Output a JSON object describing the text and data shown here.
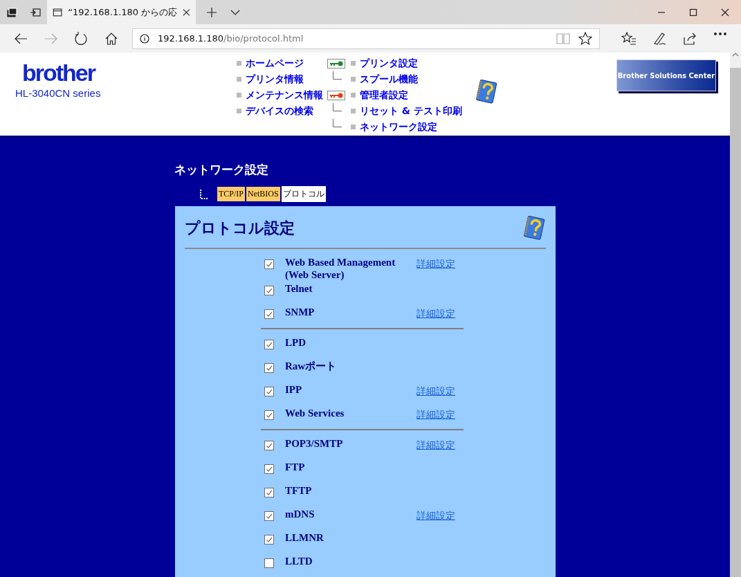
{
  "browser": {
    "tab_title": "“192.168.1.180 からの応",
    "url_host": "192.168.1.180",
    "url_path": "/bio/protocol.html"
  },
  "header": {
    "logo": "brother",
    "model": "HL-3040CN series",
    "banner": "Brother Solutions Center",
    "nav_left": [
      "ホームページ",
      "プリンタ情報",
      "メンテナンス情報",
      "デバイスの検索"
    ],
    "nav_right": [
      {
        "color": "#1a8a2a",
        "items": [
          "プリンタ設定",
          "スプール機能"
        ]
      },
      {
        "color": "#e0401a",
        "items": [
          "管理者設定",
          "リセット & テスト印刷",
          "ネットワーク設定"
        ]
      }
    ]
  },
  "section_title": "ネットワーク設定",
  "breadcrumbs": [
    {
      "label": "TCP/IP",
      "selected": false
    },
    {
      "label": "NetBIOS",
      "selected": false
    },
    {
      "label": "プロトコル",
      "selected": true
    }
  ],
  "panel": {
    "title": "プロトコル設定",
    "groups": [
      [
        {
          "label": "Web Based Management (Web Server)",
          "checked": true,
          "link": "詳細設定"
        },
        {
          "label": "Telnet",
          "checked": true
        },
        {
          "label": "SNMP",
          "checked": true,
          "link": "詳細設定"
        }
      ],
      [
        {
          "label": "LPD",
          "checked": true
        },
        {
          "label": "Rawポート",
          "checked": true
        },
        {
          "label": "IPP",
          "checked": true,
          "link": "詳細設定"
        },
        {
          "label": "Web Services",
          "checked": true,
          "link": "詳細設定"
        }
      ],
      [
        {
          "label": "POP3/SMTP",
          "checked": true,
          "link": "詳細設定"
        },
        {
          "label": "FTP",
          "checked": true
        },
        {
          "label": "TFTP",
          "checked": true
        },
        {
          "label": "mDNS",
          "checked": true,
          "link": "詳細設定"
        },
        {
          "label": "LLMNR",
          "checked": true
        },
        {
          "label": "LLTD",
          "checked": false
        }
      ]
    ]
  }
}
